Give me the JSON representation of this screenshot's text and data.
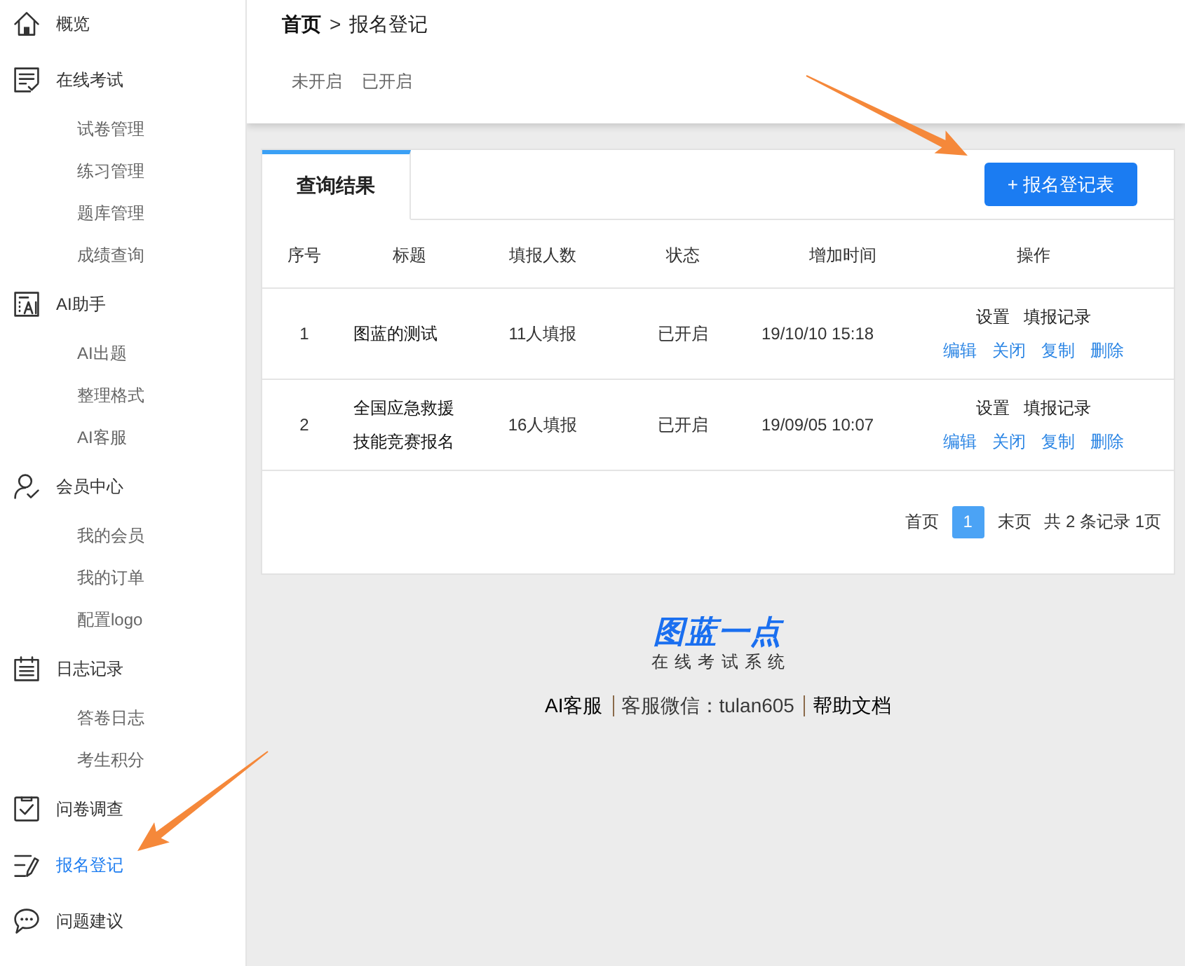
{
  "sidebar": {
    "items": [
      {
        "label": "概览",
        "selected": false
      },
      {
        "label": "在线考试",
        "selected": false,
        "children": [
          {
            "label": "试卷管理",
            "selected": false
          },
          {
            "label": "练习管理",
            "selected": false
          },
          {
            "label": "题库管理",
            "selected": false
          },
          {
            "label": "成绩查询",
            "selected": false
          }
        ]
      },
      {
        "label": "AI助手",
        "selected": false,
        "children": [
          {
            "label": "AI出题",
            "selected": false
          },
          {
            "label": "整理格式",
            "selected": false
          },
          {
            "label": "AI客服",
            "selected": false
          }
        ]
      },
      {
        "label": "会员中心",
        "selected": false,
        "children": [
          {
            "label": "我的会员",
            "selected": false
          },
          {
            "label": "我的订单",
            "selected": false
          },
          {
            "label": "配置logo",
            "selected": false
          }
        ]
      },
      {
        "label": "日志记录",
        "selected": false,
        "children": [
          {
            "label": "答卷日志",
            "selected": false
          },
          {
            "label": "考生积分",
            "selected": false
          }
        ]
      },
      {
        "label": "问卷调查",
        "selected": false
      },
      {
        "label": "报名登记",
        "selected": true
      },
      {
        "label": "问题建议",
        "selected": false
      }
    ]
  },
  "breadcrumb": [
    {
      "label": "首页",
      "kind": "link"
    },
    {
      "label": ">",
      "kind": "separator"
    },
    {
      "label": "报名登记",
      "kind": "current"
    }
  ],
  "filter_tabs": [
    {
      "label": "未开启",
      "selected": false
    },
    {
      "label": "已开启",
      "selected": false
    }
  ],
  "panel": {
    "tabs": [
      {
        "label": "查询结果",
        "selected": true
      }
    ],
    "add_button": "+ 报名登记表",
    "table": {
      "columns": [
        "序号",
        "标题",
        "填报人数",
        "状态",
        "增加时间",
        "操作"
      ],
      "rows": [
        {
          "number": "1",
          "title": "图蓝的测试",
          "entries": "11人填报",
          "status": "已开启",
          "added": "19/10/10 15:18",
          "actions": [
            "设置",
            "填报记录"
          ],
          "links": [
            "编辑",
            "关闭",
            "复制",
            "删除"
          ]
        },
        {
          "number": "2",
          "title": "全国应急救援技能竞赛报名",
          "entries": "16人填报",
          "status": "已开启",
          "added": "19/09/05 10:07",
          "actions": [
            "设置",
            "填报记录"
          ],
          "links": [
            "编辑",
            "关闭",
            "复制",
            "删除"
          ]
        }
      ]
    },
    "pagination": {
      "first": "首页",
      "pages": [
        {
          "label": "1",
          "selected": true
        }
      ],
      "last": "末页",
      "summary": "共 2 条记录 1页"
    }
  },
  "footer": {
    "logo": "图蓝一点",
    "tagline": "在线考试系统",
    "links": [
      {
        "label": "AI客服",
        "kind": "link"
      },
      {
        "label": "客服微信：tulan605",
        "kind": "text"
      },
      {
        "label": "帮助文档",
        "kind": "link"
      }
    ]
  },
  "annotations": [
    {
      "kind": "arrow"
    },
    {
      "kind": "arrow"
    }
  ]
}
